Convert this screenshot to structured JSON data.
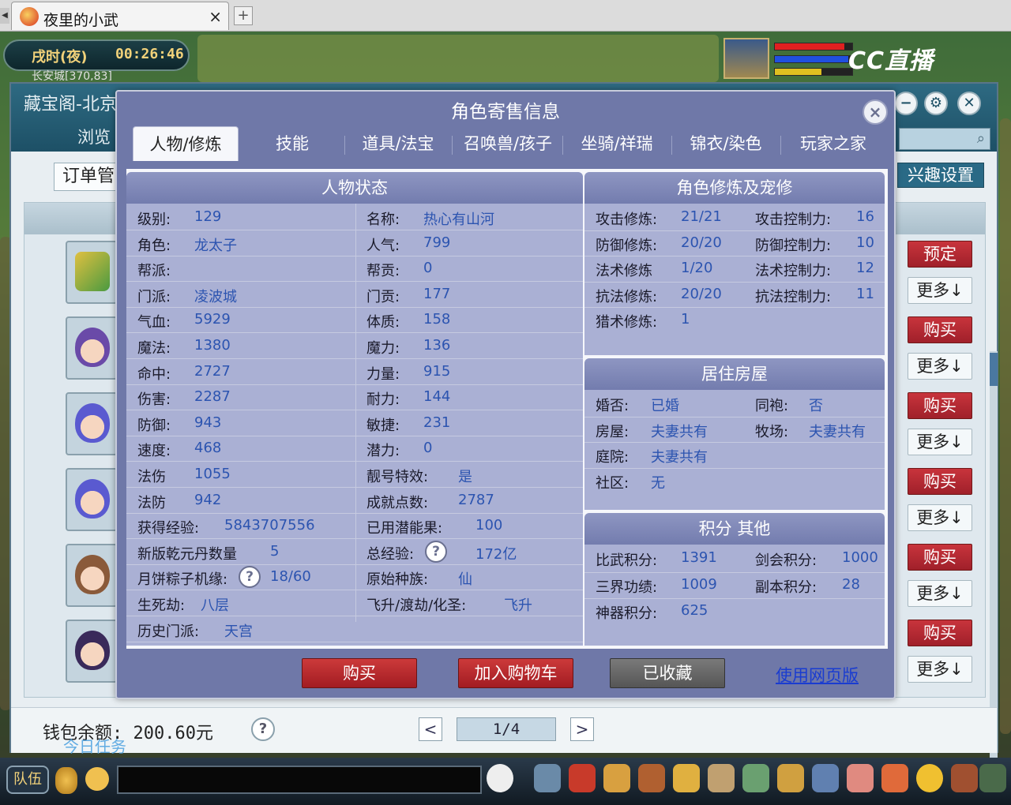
{
  "browser": {
    "tab_title": "夜里的小武",
    "tab_close": "×",
    "new_tab": "+"
  },
  "hud": {
    "shichen": "戌时(夜)",
    "time": "00:26:46",
    "coords": "长安城[370,83]",
    "cc_logo": "CC直播"
  },
  "cbg": {
    "title": "藏宝阁-北京",
    "browse_tab": "浏览",
    "order_btn": "订单管",
    "interest_btn": "兴趣设置",
    "right_buttons": [
      {
        "label": "预定",
        "kind": "red"
      },
      {
        "label": "更多↓",
        "kind": "more"
      },
      {
        "label": "购买",
        "kind": "red"
      },
      {
        "label": "更多↓",
        "kind": "more"
      },
      {
        "label": "购买",
        "kind": "red"
      },
      {
        "label": "更多↓",
        "kind": "more"
      },
      {
        "label": "购买",
        "kind": "red"
      },
      {
        "label": "更多↓",
        "kind": "more"
      },
      {
        "label": "购买",
        "kind": "red"
      },
      {
        "label": "更多↓",
        "kind": "more"
      },
      {
        "label": "购买",
        "kind": "red"
      },
      {
        "label": "更多↓",
        "kind": "more"
      }
    ],
    "wallet": "钱包余额: 200.60元",
    "help": "?",
    "page_prev": "<",
    "page_next": ">",
    "page_indicator": "1/4"
  },
  "daily_task": "今日任务",
  "gamebar": {
    "team": "队伍"
  },
  "modal": {
    "title": "角色寄售信息",
    "close": "×",
    "tabs": [
      "人物/修炼",
      "技能",
      "道具/法宝",
      "召唤兽/孩子",
      "坐骑/祥瑞",
      "锦衣/染色",
      "玩家之家"
    ],
    "status": {
      "heading": "人物状态",
      "col1": [
        {
          "label": "级别:",
          "value": "129"
        },
        {
          "label": "角色:",
          "value": "龙太子"
        },
        {
          "label": "帮派:",
          "value": ""
        },
        {
          "label": "门派:",
          "value": "凌波城"
        },
        {
          "label": "气血:",
          "value": "5929"
        },
        {
          "label": "魔法:",
          "value": "1380"
        },
        {
          "label": "命中:",
          "value": "2727"
        },
        {
          "label": "伤害:",
          "value": "2287"
        },
        {
          "label": "防御:",
          "value": "943"
        },
        {
          "label": "速度:",
          "value": "468"
        },
        {
          "label": "法伤",
          "value": "1055"
        },
        {
          "label": "法防",
          "value": "942"
        },
        {
          "label": "获得经验:",
          "value": "5843707556"
        },
        {
          "label": "新版乾元丹数量",
          "value": "5"
        },
        {
          "label": "月饼粽子机缘:",
          "value": "18/60",
          "help": "?"
        },
        {
          "label": "生死劫:",
          "value": "八层"
        },
        {
          "label": "历史门派:",
          "value": "天宫"
        }
      ],
      "col2": [
        {
          "label": "名称:",
          "value": "热心有山河"
        },
        {
          "label": "人气:",
          "value": "799"
        },
        {
          "label": "帮贡:",
          "value": "0"
        },
        {
          "label": "门贡:",
          "value": "177"
        },
        {
          "label": "体质:",
          "value": "158"
        },
        {
          "label": "魔力:",
          "value": "136"
        },
        {
          "label": "力量:",
          "value": "915"
        },
        {
          "label": "耐力:",
          "value": "144"
        },
        {
          "label": "敏捷:",
          "value": "231"
        },
        {
          "label": "潜力:",
          "value": "0"
        },
        {
          "label": "靓号特效:",
          "value": "是"
        },
        {
          "label": "成就点数:",
          "value": "2787"
        },
        {
          "label": "已用潜能果:",
          "value": "100"
        },
        {
          "label": "总经验:",
          "value": "172亿",
          "help": "?"
        },
        {
          "label": "原始种族:",
          "value": "仙"
        },
        {
          "label": "飞升/渡劫/化圣:",
          "value": "飞升"
        }
      ]
    },
    "cultivation": {
      "heading": "角色修炼及宠修",
      "rows": [
        {
          "l1": "攻击修炼:",
          "v1": "21/21",
          "l2": "攻击控制力:",
          "v2": "16"
        },
        {
          "l1": "防御修炼:",
          "v1": "20/20",
          "l2": "防御控制力:",
          "v2": "10"
        },
        {
          "l1": "法术修炼",
          "v1": "1/20",
          "l2": "法术控制力:",
          "v2": "12"
        },
        {
          "l1": "抗法修炼:",
          "v1": "20/20",
          "l2": "抗法控制力:",
          "v2": "11"
        },
        {
          "l1": "猎术修炼:",
          "v1": "1",
          "l2": "",
          "v2": ""
        }
      ]
    },
    "housing": {
      "heading": "居住房屋",
      "rows": [
        {
          "l1": "婚否:",
          "v1": "已婚",
          "l2": "同袍:",
          "v2": "否"
        },
        {
          "l1": "房屋:",
          "v1": "夫妻共有",
          "l2": "牧场:",
          "v2": "夫妻共有"
        },
        {
          "l1": "庭院:",
          "v1": "夫妻共有",
          "l2": "",
          "v2": ""
        },
        {
          "l1": "社区:",
          "v1": "无",
          "l2": "",
          "v2": ""
        }
      ]
    },
    "points": {
      "heading": "积分 其他",
      "rows": [
        {
          "l1": "比武积分:",
          "v1": "1391",
          "l2": "剑会积分:",
          "v2": "1000"
        },
        {
          "l1": "三界功绩:",
          "v1": "1009",
          "l2": "副本积分:",
          "v2": "28"
        },
        {
          "l1": "神器积分:",
          "v1": "625",
          "l2": "",
          "v2": ""
        }
      ]
    },
    "buttons": {
      "buy": "购买",
      "add_cart": "加入购物车",
      "collected": "已收藏",
      "web_version": "使用网页版"
    }
  }
}
